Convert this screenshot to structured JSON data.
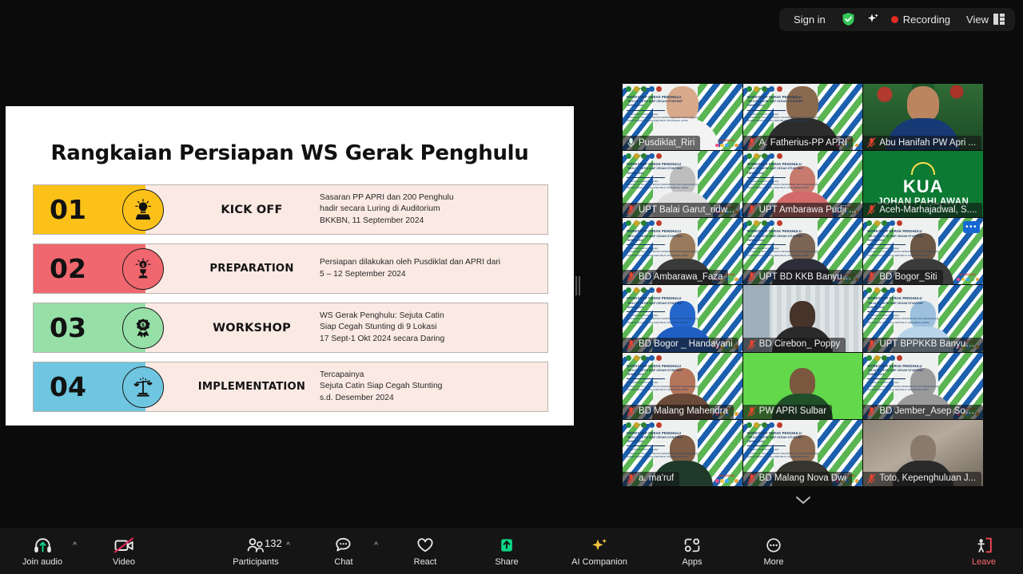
{
  "topbar": {
    "sign_in_label": "Sign in",
    "shield_icon": "shield-check-icon",
    "ai_icon": "sparkle-icon",
    "recording_label": "Recording",
    "view_label": "View",
    "view_icon": "layout-grid-icon",
    "accent_green": "#34c759",
    "recording_red": "#e02b20"
  },
  "slide": {
    "title": "Rangkaian Persiapan WS Gerak Penghulu",
    "steps": [
      {
        "number": "01",
        "label": "KICK OFF",
        "icon": "lightbulb-idea-icon",
        "color": "#fbc119",
        "desc": [
          "Sasaran PP APRI dan 200 Penghulu",
          "hadir secara Luring di Auditorium",
          "BKKBN, 11 September 2024"
        ]
      },
      {
        "number": "02",
        "label": "PREPARATION",
        "icon": "trophy-idea-icon",
        "color": "#f0676f",
        "desc": [
          "Persiapan dilakukan oleh Pusdiklat dan APRI dari",
          "5 – 12 September 2024"
        ]
      },
      {
        "number": "03",
        "label": "WORKSHOP",
        "icon": "award-medal-icon",
        "color": "#96e0a8",
        "desc": [
          "WS Gerak Penghulu: Sejuta Catin",
          "Siap Cegah Stunting di 9 Lokasi",
          "17 Sept-1 Okt 2024 secara Daring"
        ]
      },
      {
        "number": "04",
        "label": "IMPLEMENTATION",
        "icon": "scales-balance-icon",
        "color": "#6ec6e0",
        "desc": [
          "Tercapainya",
          "Sejuta Catin Siap Cegah Stunting",
          "s.d. Desember 2024"
        ]
      }
    ]
  },
  "video_grid": {
    "more_options_label": "•••",
    "scroll_down_icon": "chevron-down-icon",
    "tiles": [
      {
        "name": "Pusdiklat_Riri",
        "muted": false,
        "active": true,
        "bg": "banner",
        "skin": "#c58a62",
        "cloth": "#f3f3f3",
        "head": "#d8a98a"
      },
      {
        "name": "A. Fatherius-PP APRI",
        "muted": true,
        "active": false,
        "bg": "banner",
        "skin": "#7a5a42",
        "cloth": "#2c2c2c",
        "head": "#8a6a4e"
      },
      {
        "name": "Abu Hanifah PW Apri ...",
        "muted": true,
        "active": false,
        "bg": "photo-leaf",
        "skin": "#b07b55",
        "cloth": "#173a76",
        "head": "#bb8560"
      },
      {
        "name": "UPT Balai Garut_ridw...",
        "muted": true,
        "active": false,
        "bg": "banner",
        "skin": "#a8a8a8",
        "cloth": "#dedede",
        "head": "#bdbdbd"
      },
      {
        "name": "UPT Ambarawa Pudji ...",
        "muted": true,
        "active": false,
        "bg": "banner",
        "skin": "#b56c63",
        "cloth": "#d26a6a",
        "head": "#c77a6e"
      },
      {
        "name": "Aceh-Marhajadwal, S....",
        "muted": true,
        "active": false,
        "bg": "kua",
        "skin": "#0d7a33",
        "cloth": "#0d7a33",
        "head": "#0d7a33"
      },
      {
        "name": "BD Ambarawa_Faza",
        "muted": true,
        "active": false,
        "bg": "banner",
        "skin": "#8a6a50",
        "cloth": "#3a3a3a",
        "head": "#9a7a5c"
      },
      {
        "name": "UPT BD KKB Banyuma...",
        "muted": true,
        "active": false,
        "bg": "banner",
        "skin": "#6e5a4a",
        "cloth": "#2e2e3a",
        "head": "#7d6554"
      },
      {
        "name": "BD Bogor_Siti",
        "muted": true,
        "active": false,
        "bg": "banner",
        "skin": "#5c4a3a",
        "cloth": "#3b3b3b",
        "head": "#6b5744"
      },
      {
        "name": "BD Bogor _ Handayani",
        "muted": true,
        "active": false,
        "bg": "banner",
        "skin": "#1f5fc4",
        "cloth": "#1f5fc4",
        "head": "#2566cc"
      },
      {
        "name": "BD Cirebon_ Poppy",
        "muted": true,
        "active": false,
        "bg": "room",
        "skin": "#3a2a22",
        "cloth": "#2a2a2a",
        "head": "#46332a"
      },
      {
        "name": "UPT BPPKKB Banyum...",
        "muted": true,
        "active": false,
        "bg": "banner",
        "skin": "#8fb6d8",
        "cloth": "#b9d4ea",
        "head": "#9cc0de"
      },
      {
        "name": "BD Malang Mahendra",
        "muted": true,
        "active": false,
        "bg": "banner",
        "skin": "#a8694a",
        "cloth": "#6a4a38",
        "head": "#b4755a"
      },
      {
        "name": "PW APRI Sulbar",
        "muted": true,
        "active": false,
        "bg": "green",
        "skin": "#6c4a33",
        "cloth": "#20502a",
        "head": "#7b573e"
      },
      {
        "name": "BD Jember_Asep Sop...",
        "muted": true,
        "active": false,
        "bg": "banner",
        "skin": "#8a8a8a",
        "cloth": "#9a9a9a",
        "head": "#9b9b9b"
      },
      {
        "name": "a. ma'ruf",
        "muted": true,
        "active": false,
        "bg": "banner",
        "skin": "#6f4f3a",
        "cloth": "#1f3a2a",
        "head": "#7e5c45"
      },
      {
        "name": "BD Malang Nova Dwi",
        "muted": true,
        "active": false,
        "bg": "banner",
        "skin": "#7a5a44",
        "cloth": "#36362f",
        "head": "#8b6a51"
      },
      {
        "name": "Toto, Kepenghuluan J...",
        "muted": true,
        "active": false,
        "bg": "blur",
        "skin": "#7a6a5c",
        "cloth": "#2a2a2a",
        "head": "#8a7a6c"
      }
    ],
    "banner_title_line1": "WORKSHOP GERAK PENGHULU",
    "banner_title_line2": "\"SEJUTA CATIN SIAP CEGAH STUNTING\"",
    "banner_title_line3": "TAHUN 2024",
    "banner_sub1": "DISELENGGARAKAN OLEH",
    "banner_sub2": "PUSDIKLAT TENAGA TEKNIS PENDIDIKAN DAN KEAGAMAAN",
    "banner_sub3": "KEMENTERIAN AGAMA REPUBLIK INDONESIA (APRI)"
  },
  "toolbar": {
    "join_audio_label": "Join audio",
    "join_audio_icon": "headset-icon",
    "video_label": "Video",
    "video_icon": "camera-off-icon",
    "participants_label": "Participants",
    "participants_count": "132",
    "participants_icon": "people-icon",
    "chat_label": "Chat",
    "chat_icon": "chat-bubble-icon",
    "react_label": "React",
    "react_icon": "heart-icon",
    "share_label": "Share",
    "share_icon": "share-screen-icon",
    "ai_companion_label": "AI Companion",
    "ai_companion_icon": "sparkle-icon",
    "apps_label": "Apps",
    "apps_icon": "apps-icon",
    "more_label": "More",
    "more_icon": "ellipsis-circle-icon",
    "leave_label": "Leave",
    "leave_icon": "leave-door-icon",
    "share_green": "#0bd988",
    "leave_red": "#ff4757",
    "caret_icon": "chevron-up-icon"
  }
}
